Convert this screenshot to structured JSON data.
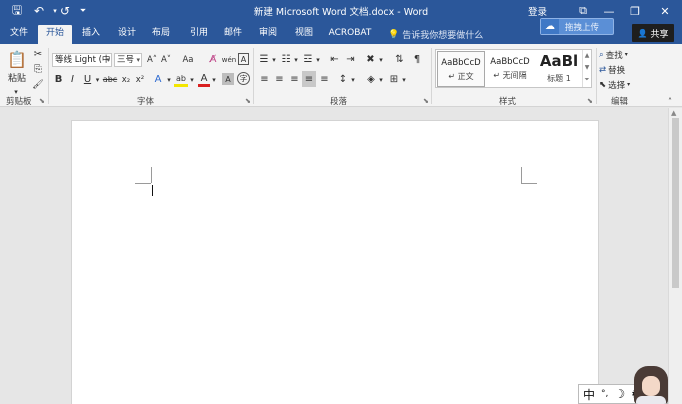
{
  "titlebar": {
    "title": "新建 Microsoft Word 文档.docx - Word",
    "login": "登录"
  },
  "quick_access": {
    "save": "🖫",
    "undo": "↶",
    "redo": "↺",
    "customize": "⏷"
  },
  "window_controls": {
    "restore_ribbon": "⧉",
    "minimize": "—",
    "maximize": "❐",
    "close": "✕"
  },
  "tabs": [
    {
      "label": "文件",
      "active": false
    },
    {
      "label": "开始",
      "active": true
    },
    {
      "label": "插入",
      "active": false
    },
    {
      "label": "设计",
      "active": false
    },
    {
      "label": "布局",
      "active": false
    },
    {
      "label": "引用",
      "active": false
    },
    {
      "label": "邮件",
      "active": false
    },
    {
      "label": "审阅",
      "active": false
    },
    {
      "label": "视图",
      "active": false
    },
    {
      "label": "ACROBAT",
      "active": false
    }
  ],
  "tell_me": {
    "placeholder": "告诉我你想要做什么",
    "icon": "💡"
  },
  "upload": {
    "label": "拖拽上传",
    "icon": "☁"
  },
  "share": {
    "label": "共享",
    "icon": "👤"
  },
  "clipboard": {
    "group": "剪贴板",
    "paste": "粘贴",
    "cut": "✂",
    "copy": "⎘",
    "format_painter": "🖌"
  },
  "font": {
    "group": "字体",
    "font_name": "等线 Light (中",
    "font_size": "三号",
    "grow": "A˄",
    "shrink": "A˅",
    "case": "Aa",
    "clear": "A̸",
    "phonetic": "wén",
    "border": "A",
    "bold": "B",
    "italic": "I",
    "underline": "U",
    "strike": "abc",
    "subscript": "x₂",
    "superscript": "x²",
    "effects": "A",
    "highlight": "ab",
    "color": "A",
    "shade": "A",
    "circle": "字"
  },
  "paragraph": {
    "group": "段落",
    "bullets": "☰",
    "numbering": "☷",
    "multilevel": "☲",
    "decrease_indent": "⇤",
    "increase_indent": "⇥",
    "chinese_layout": "✖",
    "sort": "⇅",
    "show_marks": "¶",
    "align_left": "≡",
    "align_center": "≡",
    "align_right": "≡",
    "justify": "≡",
    "distributed": "≡",
    "line_spacing": "↕",
    "shading": "◈",
    "borders": "⊞"
  },
  "styles": {
    "group": "样式",
    "items": [
      {
        "preview": "AaBbCcD",
        "name": "↵ 正文"
      },
      {
        "preview": "AaBbCcD",
        "name": "↵ 无间隔"
      },
      {
        "preview": "AaBl",
        "name": "标题 1"
      }
    ]
  },
  "editing": {
    "group": "编辑",
    "find": "查找",
    "replace": "替换",
    "select": "选择"
  },
  "ime": {
    "mode": "中",
    "punct": "°,",
    "moon": "☽",
    "settings": "⚙"
  }
}
